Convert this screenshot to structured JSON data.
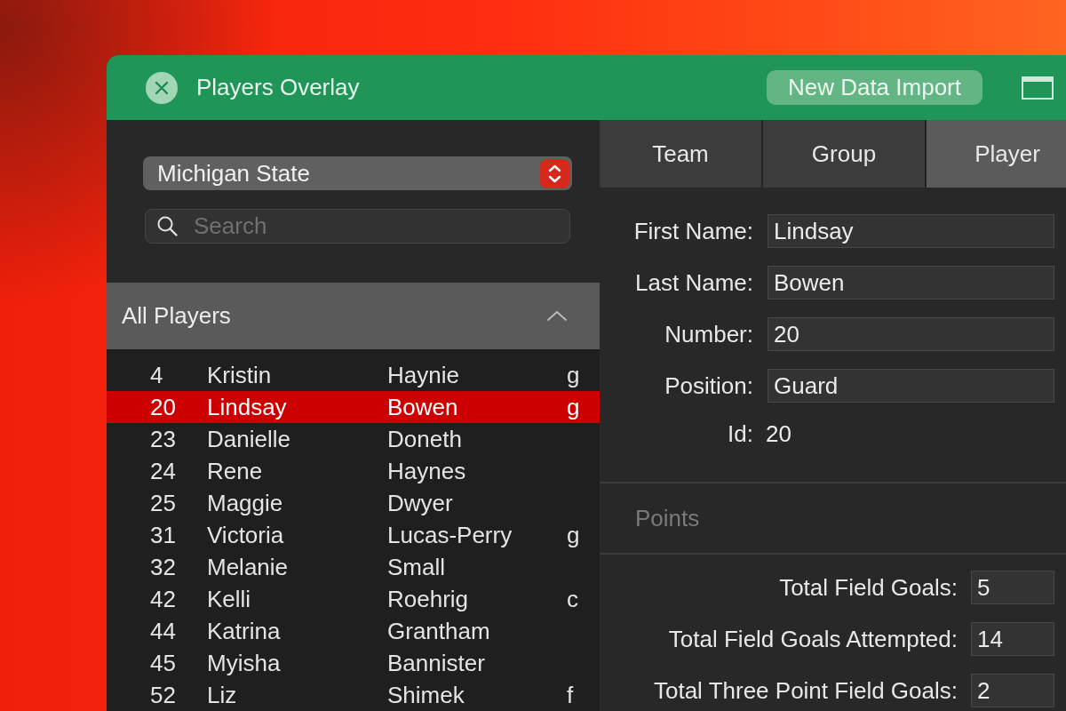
{
  "window": {
    "title": "Players Overlay",
    "import_button": "New Data Import"
  },
  "team_select": {
    "value": "Michigan State"
  },
  "search": {
    "placeholder": "Search"
  },
  "players_section": {
    "title": "All Players",
    "expanded": true
  },
  "players": [
    {
      "number": "4",
      "first_name": "Kristin",
      "last_name": "Haynie",
      "position": "g",
      "selected": false
    },
    {
      "number": "20",
      "first_name": "Lindsay",
      "last_name": "Bowen",
      "position": "g",
      "selected": true
    },
    {
      "number": "23",
      "first_name": "Danielle",
      "last_name": "Doneth",
      "selected": false
    },
    {
      "number": "24",
      "first_name": "Rene",
      "last_name": "Haynes",
      "selected": false
    },
    {
      "number": "25",
      "first_name": "Maggie",
      "last_name": "Dwyer",
      "selected": false
    },
    {
      "number": "31",
      "first_name": "Victoria",
      "last_name": "Lucas-Perry",
      "position": "g",
      "selected": false
    },
    {
      "number": "32",
      "first_name": "Melanie",
      "last_name": "Small",
      "selected": false
    },
    {
      "number": "42",
      "first_name": "Kelli",
      "last_name": "Roehrig",
      "position": "c",
      "selected": false
    },
    {
      "number": "44",
      "first_name": "Katrina",
      "last_name": "Grantham",
      "selected": false
    },
    {
      "number": "45",
      "first_name": "Myisha",
      "last_name": "Bannister",
      "selected": false
    },
    {
      "number": "52",
      "first_name": "Liz",
      "last_name": "Shimek",
      "position": "f",
      "selected": false
    }
  ],
  "tabs": [
    {
      "label": "Team",
      "selected": false
    },
    {
      "label": "Group",
      "selected": false
    },
    {
      "label": "Player",
      "selected": true
    }
  ],
  "player_form": {
    "fields": [
      {
        "label": "First Name:",
        "value": "Lindsay"
      },
      {
        "label": "Last Name:",
        "value": "Bowen"
      },
      {
        "label": "Number:",
        "value": "20"
      },
      {
        "label": "Position:",
        "value": "Guard"
      }
    ],
    "id": {
      "label": "Id:",
      "value": "20"
    }
  },
  "points": {
    "title": "Points",
    "fields": [
      {
        "label": "Total Field Goals:",
        "value": "5"
      },
      {
        "label": "Total Field Goals Attempted:",
        "value": "14"
      },
      {
        "label": "Total Three Point Field Goals:",
        "value": "2"
      }
    ]
  }
}
